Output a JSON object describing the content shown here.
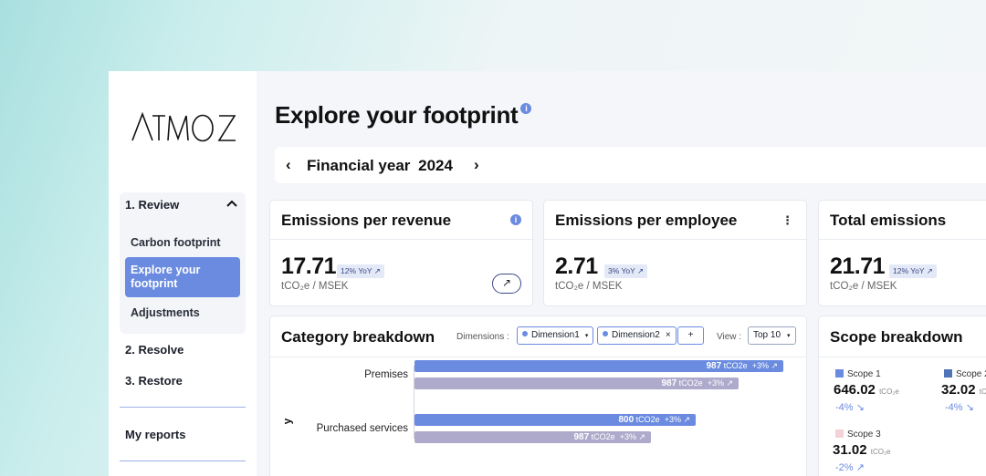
{
  "app": {
    "logo_text": "ATMOZ"
  },
  "sidebar": {
    "review_label": "1. Review",
    "sub_items": [
      "Carbon footprint",
      "Explore your footprint",
      "Adjustments"
    ],
    "resolve_label": "2. Resolve",
    "restore_label": "3. Restore",
    "my_reports_label": "My reports"
  },
  "page": {
    "title": "Explore your footprint",
    "info_icon": "i"
  },
  "year_bar": {
    "label": "Financial year",
    "year": "2024",
    "prev_icon": "‹",
    "next_icon": "›"
  },
  "kpis": [
    {
      "title": "Emissions per revenue",
      "value": "17.71",
      "badge": "12% YoY ↗",
      "unit": "tCO₂e / MSEK"
    },
    {
      "title": "Emissions per employee",
      "value": "2.71",
      "badge": "3% YoY ↗",
      "unit": "tCO₂e / MSEK"
    },
    {
      "title": "Total emissions",
      "value": "21.71",
      "badge": "12% YoY ↗",
      "unit": "tCO₂e / MSEK"
    }
  ],
  "category": {
    "title": "Category breakdown",
    "dimensions_label": "Dimensions :",
    "dimension_chips": [
      "Dimension1",
      "Dimension2"
    ],
    "add_label": "+",
    "view_label": "View :",
    "view_value": "Top 10",
    "y_axis_fragment": "y",
    "rows": [
      {
        "label": "Premises",
        "bars": [
          {
            "value": "987",
            "unit": "tCO2e",
            "change": "+3% ↗"
          },
          {
            "value": "987",
            "unit": "tCO2e",
            "change": "+3% ↗"
          }
        ]
      },
      {
        "label": "Purchased services",
        "bars": [
          {
            "value": "800",
            "unit": "tCO2e",
            "change": "+3% ↗"
          },
          {
            "value": "987",
            "unit": "tCO2e",
            "change": "+3% ↗"
          }
        ]
      }
    ]
  },
  "scope": {
    "title": "Scope breakdown",
    "items": [
      {
        "label": "Scope 1",
        "value": "646.02",
        "unit": "tCO₂e",
        "change": "-4% ↘",
        "color": "#6a8be0"
      },
      {
        "label": "Scope 2",
        "value": "32.02",
        "unit": "tC",
        "change": "-4% ↘",
        "color": "#4f74b8"
      },
      {
        "label": "Scope 3",
        "value": "31.02",
        "unit": "tCO₂e",
        "change": "-2% ↗",
        "color": "#f2d2d6"
      }
    ]
  },
  "colors": {
    "accent": "#6a8be0",
    "secondary_bar": "#aeaacb"
  }
}
